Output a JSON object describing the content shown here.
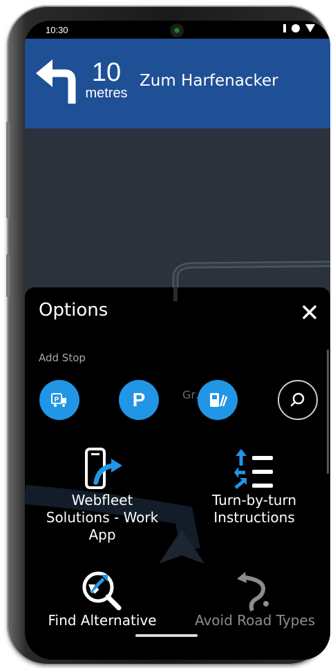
{
  "status_bar": {
    "time": "10:30"
  },
  "navigation": {
    "distance_value": "10",
    "distance_unit": "metres",
    "street_name": "Zum Harfenacker"
  },
  "map": {
    "street_label": "Gr…aße"
  },
  "options": {
    "title": "Options",
    "add_stop_label": "Add Stop",
    "add_stop_items": [
      {
        "name": "truck-parking",
        "icon": "truck-parking-icon"
      },
      {
        "name": "parking",
        "icon": "parking-icon",
        "glyph": "P"
      },
      {
        "name": "fuel",
        "icon": "fuel-station-icon"
      },
      {
        "name": "search",
        "icon": "search-icon"
      }
    ],
    "menu_items": [
      {
        "label": "Webfleet Solutions - Work App",
        "icon": "phone-share-icon",
        "enabled": true
      },
      {
        "label": "Turn-by-turn Instructions",
        "icon": "turn-list-icon",
        "enabled": true
      },
      {
        "label": "Find Alternative",
        "icon": "find-alternative-icon",
        "enabled": true
      },
      {
        "label": "Avoid Road Types",
        "icon": "avoid-road-icon",
        "enabled": false
      }
    ]
  },
  "colors": {
    "banner_blue": "#1f5096",
    "accent_blue": "#2196e6",
    "panel_black": "#000000",
    "map_gray": "#2b323c"
  }
}
